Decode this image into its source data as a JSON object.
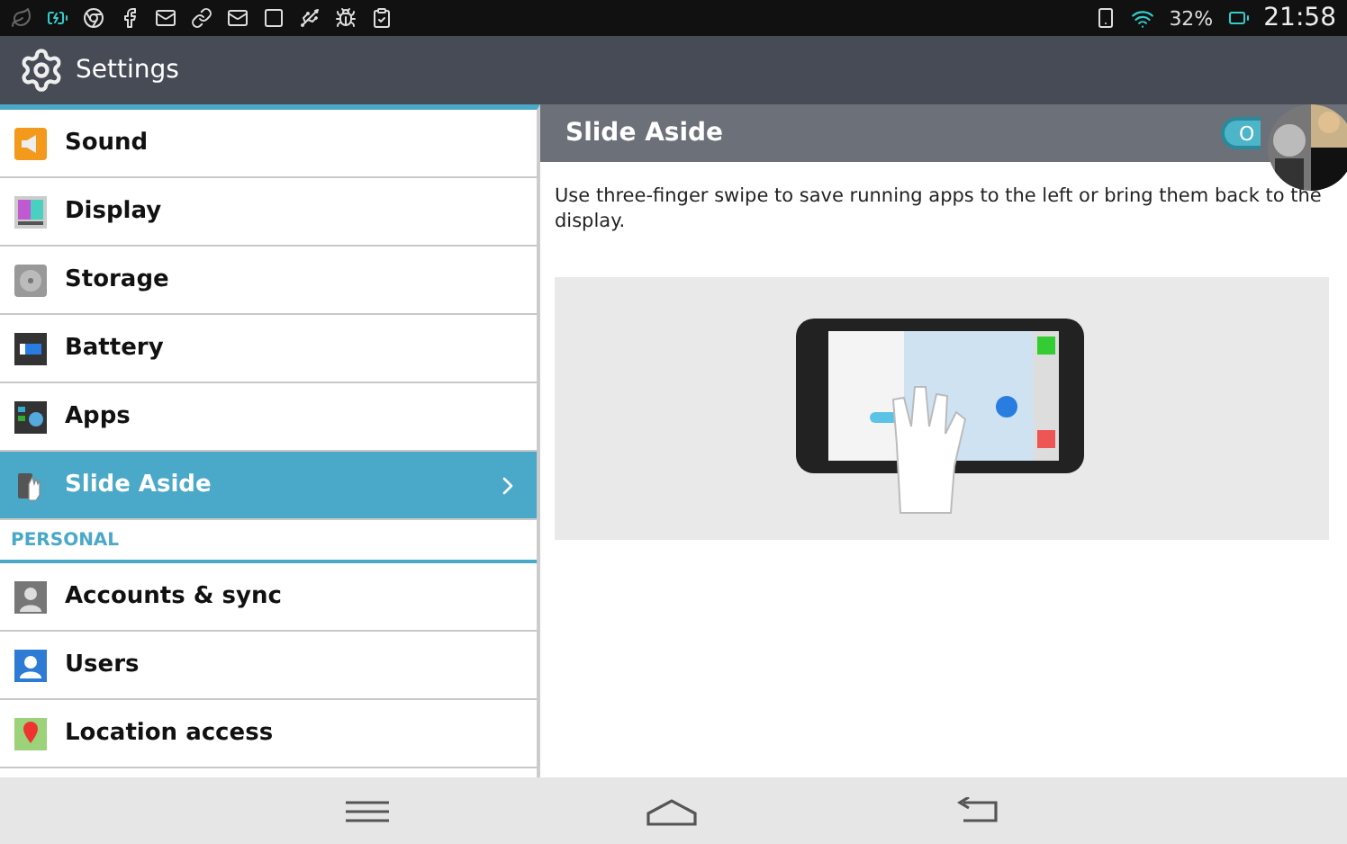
{
  "status_bar": {
    "battery_percent": "32%",
    "time": "21:58"
  },
  "app_bar": {
    "title": "Settings"
  },
  "sidebar": {
    "items": [
      {
        "kind": "item",
        "label": "Sound",
        "selected": false
      },
      {
        "kind": "item",
        "label": "Display",
        "selected": false
      },
      {
        "kind": "item",
        "label": "Storage",
        "selected": false
      },
      {
        "kind": "item",
        "label": "Battery",
        "selected": false
      },
      {
        "kind": "item",
        "label": "Apps",
        "selected": false
      },
      {
        "kind": "item",
        "label": "Slide Aside",
        "selected": true
      },
      {
        "kind": "header",
        "label": "PERSONAL"
      },
      {
        "kind": "item",
        "label": "Accounts & sync",
        "selected": false
      },
      {
        "kind": "item",
        "label": "Users",
        "selected": false
      },
      {
        "kind": "item",
        "label": "Location access",
        "selected": false
      }
    ]
  },
  "detail": {
    "title": "Slide Aside",
    "toggle": {
      "label": "O",
      "on": true
    },
    "description": "Use three-finger swipe to save running apps to the left or bring them back to the display."
  }
}
